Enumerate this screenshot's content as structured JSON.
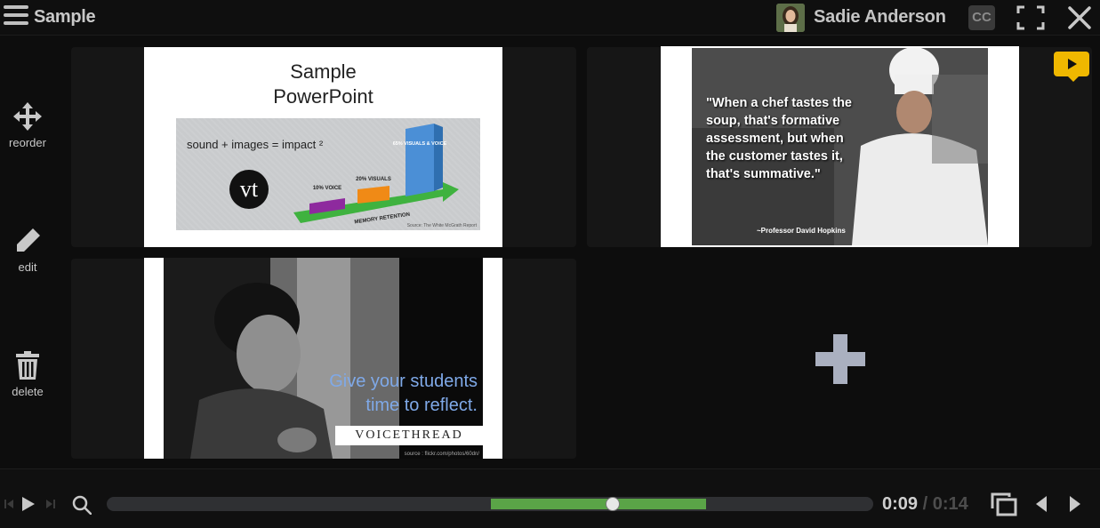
{
  "header": {
    "title": "Sample",
    "user_name": "Sadie Anderson",
    "cc_label": "CC"
  },
  "toolbar": {
    "reorder_label": "reorder",
    "edit_label": "edit",
    "delete_label": "delete"
  },
  "slides": [
    {
      "title_line1": "Sample",
      "title_line2": "PowerPoint",
      "equation": "sound + images = impact ²",
      "bar_labels": [
        "10% VOICE",
        "20% VISUALS",
        "65% VISUALS & VOICE"
      ],
      "axis_label": "MEMORY RETENTION",
      "logo_text": "vt",
      "source": "Source: The White McGrath Report"
    },
    {
      "quote": "\"When a chef tastes the soup, that's formative assessment, but when the customer tastes it, that's summative.\"",
      "author": "~Professor David Hopkins"
    },
    {
      "text_line1": "Give your students",
      "text_line2": "time to reflect.",
      "brand": "VOICETHREAD",
      "source": "source : flickr.com/photos/60dn/"
    }
  ],
  "player": {
    "current_time": "0:09",
    "separator": "/",
    "total_time": "0:14",
    "progress_fraction": 0.66
  },
  "colors": {
    "accent_green": "#5aa447",
    "comment_badge": "#f0b800",
    "slide3_text": "#7fa9e8"
  }
}
